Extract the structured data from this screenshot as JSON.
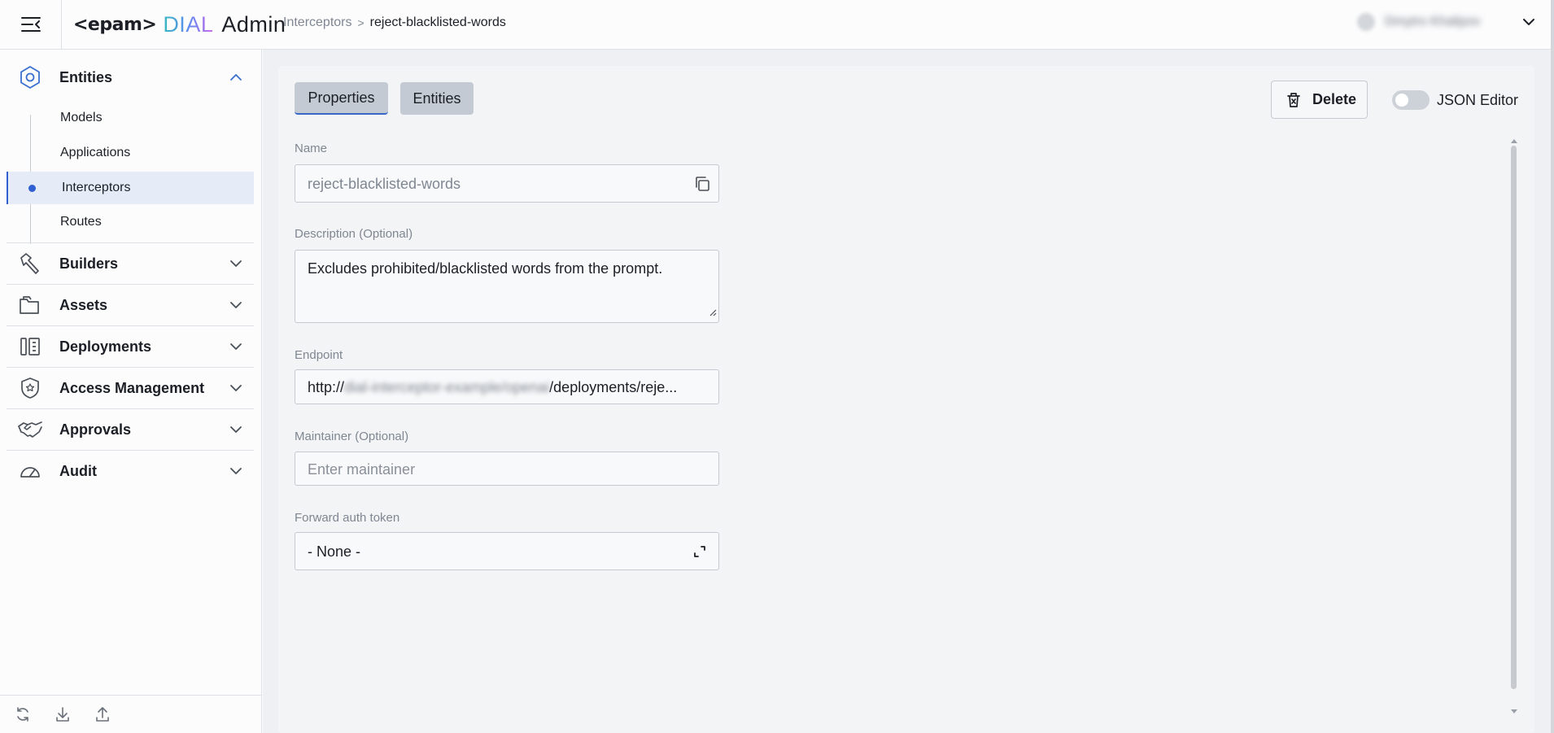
{
  "header": {
    "logo": {
      "epam": "<epam>",
      "dial": "DIAL",
      "admin": "Admin"
    },
    "breadcrumb": {
      "parent": "Interceptors",
      "separator": ">",
      "current": "reject-blacklisted-words"
    },
    "user_name": "Dmytro Khalipov"
  },
  "sidebar": {
    "groups": [
      {
        "label": "Entities",
        "icon": "hexagon-icon",
        "expanded": true
      },
      {
        "label": "Builders",
        "icon": "hammer-icon",
        "expanded": false
      },
      {
        "label": "Assets",
        "icon": "folders-icon",
        "expanded": false
      },
      {
        "label": "Deployments",
        "icon": "deployments-icon",
        "expanded": false
      },
      {
        "label": "Access Management",
        "icon": "shield-star-icon",
        "expanded": false
      },
      {
        "label": "Approvals",
        "icon": "handshake-icon",
        "expanded": false
      },
      {
        "label": "Audit",
        "icon": "gauge-icon",
        "expanded": false
      }
    ],
    "entities_items": [
      {
        "label": "Models",
        "active": false
      },
      {
        "label": "Applications",
        "active": false
      },
      {
        "label": "Interceptors",
        "active": true
      },
      {
        "label": "Routes",
        "active": false
      }
    ],
    "bottom_icons": [
      "refresh-icon",
      "download-icon",
      "upload-icon"
    ]
  },
  "tabs": [
    {
      "label": "Properties",
      "active": true
    },
    {
      "label": "Entities",
      "active": false
    }
  ],
  "toolbar": {
    "delete_label": "Delete",
    "json_editor_label": "JSON Editor",
    "json_editor_on": false
  },
  "form": {
    "name": {
      "label": "Name",
      "value": "reject-blacklisted-words"
    },
    "description": {
      "label": "Description",
      "optional": "(Optional)",
      "value": "Excludes prohibited/blacklisted words from the prompt."
    },
    "endpoint": {
      "label": "Endpoint",
      "prefix": "http://",
      "hidden": "dial-interceptor-example/openai",
      "suffix": "/deployments/reje..."
    },
    "maintainer": {
      "label": "Maintainer",
      "optional": "(Optional)",
      "placeholder": "Enter maintainer"
    },
    "forward_auth_token": {
      "label": "Forward auth token",
      "value": "- None -"
    }
  },
  "colors": {
    "accent": "#2f5fd0",
    "active_bg": "#e5ebf7",
    "tab_bg": "#c4cad3"
  }
}
